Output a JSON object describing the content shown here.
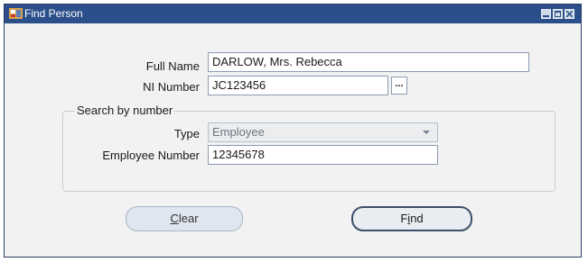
{
  "window": {
    "title": "Find Person"
  },
  "form": {
    "full_name_label": "Full Name",
    "full_name_value": "DARLOW, Mrs. Rebecca",
    "ni_number_label": "NI Number",
    "ni_number_value": "JC123456",
    "lov_button_label": "..."
  },
  "search_group": {
    "legend": "Search by number",
    "type_label": "Type",
    "type_value": "Employee",
    "employee_number_label": "Employee Number",
    "employee_number_value": "12345678"
  },
  "buttons": {
    "clear_mnemonic": "C",
    "clear_rest": "lear",
    "find_pre": "F",
    "find_mnemonic": "i",
    "find_post": "nd"
  },
  "colors": {
    "title_bar": "#2b4f8a",
    "window_bg": "#f2f2f2",
    "field_border": "#8c9bb0"
  },
  "icons": {
    "app": "oracle-forms-icon",
    "minimize": "minimize-icon",
    "maximize": "maximize-icon",
    "close": "close-icon"
  }
}
